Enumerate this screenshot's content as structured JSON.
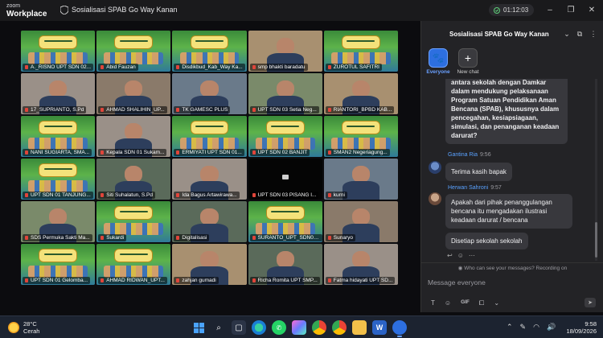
{
  "app": {
    "logo_top": "zoom",
    "logo_bottom": "Workplace",
    "window_title": "Sosialisasi SPAB Go Way Kanan",
    "timer": "01:12:03"
  },
  "tiles": [
    {
      "name": "A._RISNO UPT SDN 02...",
      "style": "banner"
    },
    {
      "name": "Abid Fauzan",
      "style": "banner"
    },
    {
      "name": "Disdikbud_Kab_Way Ka...",
      "style": "banner"
    },
    {
      "name": "smp bhakti baradatu",
      "style": "person"
    },
    {
      "name": "ZUROTUL SAFITRI",
      "style": "banner"
    },
    {
      "name": "17_SUPRIANTO, S.Pd",
      "style": "person"
    },
    {
      "name": "AHMAD SHALIHIN_UP...",
      "style": "person"
    },
    {
      "name": "TK GAMESC PLUS",
      "style": "person"
    },
    {
      "name": "UPT SDN 03 Setia Neg...",
      "style": "person"
    },
    {
      "name": "RIANTORI_BPBD KAB...",
      "style": "person"
    },
    {
      "name": "NANI SUGIARTA, SMA...",
      "style": "banner"
    },
    {
      "name": "Kepala SDN 01 Sukam...",
      "style": "person"
    },
    {
      "name": "ERMIYATI UPT SDN 01...",
      "style": "banner"
    },
    {
      "name": "UPT SDN 02 BANJIT",
      "style": "banner"
    },
    {
      "name": "SMAN2 Negeriagung...",
      "style": "banner"
    },
    {
      "name": "UPT SDN 01 TANJUNG...",
      "style": "banner"
    },
    {
      "name": "Siti Suhalatun, S.Pd",
      "style": "person"
    },
    {
      "name": "Ida Bagus Artawirawa...",
      "style": "person"
    },
    {
      "name": "UPT SDN 03 PISANG I...",
      "style": "dark"
    },
    {
      "name": "kurni",
      "style": "person"
    },
    {
      "name": "SDS Permuka Sakti Ma...",
      "style": "person"
    },
    {
      "name": "Sukardi",
      "style": "banner"
    },
    {
      "name": "Digitalisasi",
      "style": "person"
    },
    {
      "name": "SURANTO_UPT_SDN01...",
      "style": "banner"
    },
    {
      "name": "Sunaryo",
      "style": "person"
    },
    {
      "name": "UPT SDN 01 Gelomba...",
      "style": "banner"
    },
    {
      "name": "AHMAD RIDWAN_UPT...",
      "style": "banner"
    },
    {
      "name": "zahjan gumadi",
      "style": "person"
    },
    {
      "name": "Richa Romita UPT SMP...",
      "style": "person"
    },
    {
      "name": "Fatma hidayati UPT SD...",
      "style": "person"
    }
  ],
  "chat": {
    "title": "Sosialisasi SPAB Go Way Kanan",
    "tabs": [
      {
        "label": "Everyone"
      },
      {
        "label": "New chat"
      }
    ],
    "messages": [
      {
        "text": "antara sekolah dengan Damkar dalam mendukung pelaksanaan Program Satuan Pendidikan Aman Bencana (SPAB), khususnya dalam pencegahan, kesiapsiagaan, simulasi, dan penanganan keadaan darurat?"
      },
      {
        "sender": "Gantina Ria",
        "time": "9:56",
        "text": "Terima kasih bapak"
      },
      {
        "sender": "Herwan Sahroni",
        "time": "9:57",
        "text": "Apakah dari pihak penanggulangan bencana itu mengadakan ilustrasi keadaan darurat / bencana"
      },
      {
        "text": "Disetiap sekolah sekolah"
      }
    ],
    "seen_text": "Who can see your messages? Recording on",
    "input_placeholder": "Message everyone"
  },
  "taskbar": {
    "temperature": "28°C",
    "condition": "Cerah",
    "time": "9:58",
    "date": "18/09/2026"
  }
}
